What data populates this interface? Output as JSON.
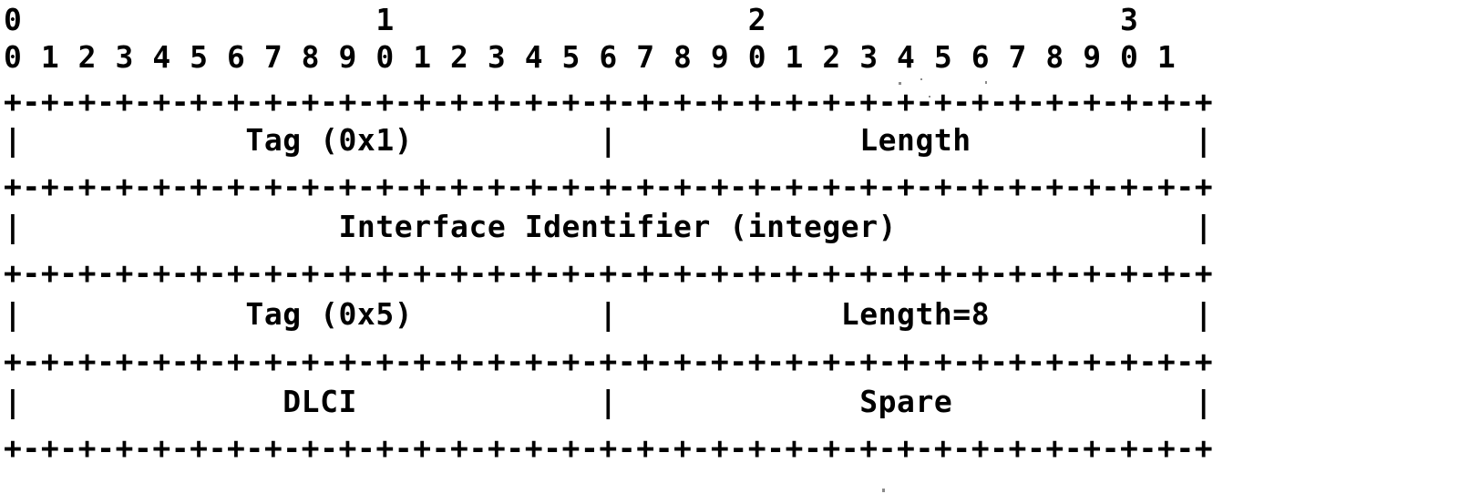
{
  "diagram": {
    "kind": "rfc-packet-format-ascii-art",
    "bit_width": 32,
    "ruler": {
      "word_markers_line": "0                   1                   2                   3",
      "bit_numbers_line": "0 1 2 3 4 5 6 7 8 9 0 1 2 3 4 5 6 7 8 9 0 1 2 3 4 5 6 7 8 9 0 1",
      "word_markers": [
        "0",
        "1",
        "2",
        "3"
      ],
      "bit_numbers": [
        "0",
        "1",
        "2",
        "3",
        "4",
        "5",
        "6",
        "7",
        "8",
        "9",
        "0",
        "1",
        "2",
        "3",
        "4",
        "5",
        "6",
        "7",
        "8",
        "9",
        "0",
        "1",
        "2",
        "3",
        "4",
        "5",
        "6",
        "7",
        "8",
        "9",
        "0",
        "1"
      ]
    },
    "separator_line": "+-+-+-+-+-+-+-+-+-+-+-+-+-+-+-+-+-+-+-+-+-+-+-+-+-+-+-+-+-+-+-+-+",
    "rows": [
      {
        "id": "row-tag-length",
        "line": "|            Tag (0x1)          |             Length            |",
        "fields": [
          {
            "label": "Tag (0x1)",
            "bits": 16
          },
          {
            "label": "Length",
            "bits": 16
          }
        ]
      },
      {
        "id": "row-interface-identifier",
        "line": "|                 Interface Identifier (integer)                |",
        "fields": [
          {
            "label": "Interface Identifier (integer)",
            "bits": 32
          }
        ]
      },
      {
        "id": "row-tag-length8",
        "line": "|            Tag (0x5)          |            Length=8           |",
        "fields": [
          {
            "label": "Tag (0x5)",
            "bits": 16
          },
          {
            "label": "Length=8",
            "bits": 16
          }
        ]
      },
      {
        "id": "row-dlci-spare",
        "line": "|              DLCI             |             Spare             |",
        "fields": [
          {
            "label": "DLCI",
            "bits": 16
          },
          {
            "label": "Spare",
            "bits": 16
          }
        ]
      }
    ],
    "colors": {
      "ink": "#000000",
      "paper": "#ffffff"
    }
  }
}
